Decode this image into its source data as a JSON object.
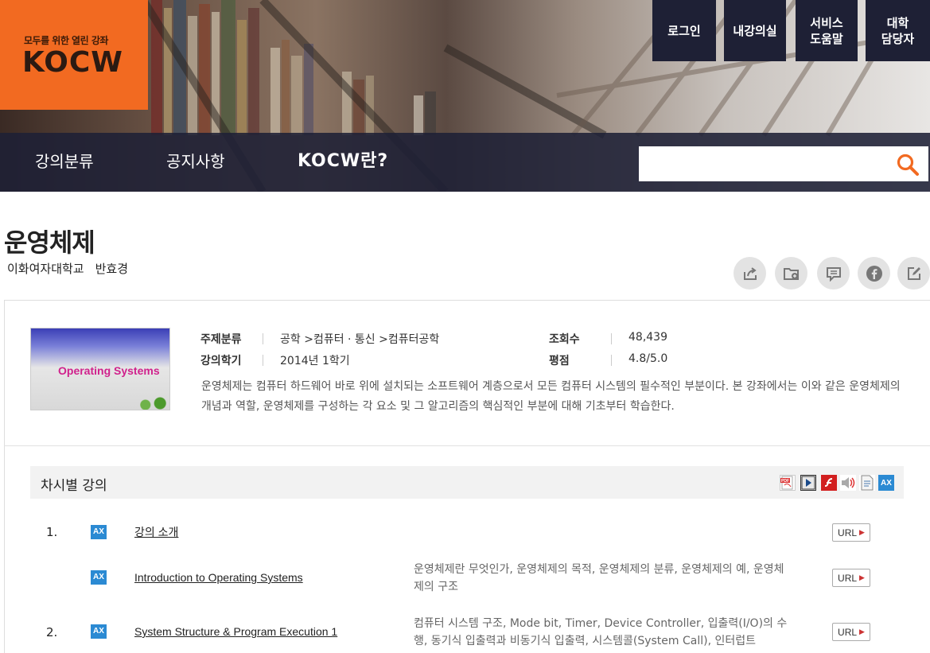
{
  "header": {
    "logo_tagline": "모두를 위한 열린 강좌",
    "logo_word": "KOCW",
    "top_buttons": [
      "로그인",
      "내강의실",
      "서비스\n도움말",
      "대학\n담당자"
    ],
    "nav": [
      "강의분류",
      "공지사항",
      "KOCW란?"
    ],
    "search": {
      "value": "",
      "placeholder": ""
    }
  },
  "course": {
    "title": "운영체제",
    "university": "이화여자대학교",
    "professor": "반효경",
    "thumbnail_title": "Operating Systems",
    "meta": {
      "subject_label": "주제분류",
      "subject_value": "공학 >컴퓨터 · 통신 >컴퓨터공학",
      "term_label": "강의학기",
      "term_value": "2014년 1학기",
      "views_label": "조회수",
      "views_value": "48,439",
      "rating_label": "평점",
      "rating_value": "4.8/5.0"
    },
    "description": "운영체제는 컴퓨터 하드웨어 바로 위에 설치되는 소프트웨어 계층으로서 모든 컴퓨터 시스템의 필수적인 부분이다. 본 강좌에서는 이와 같은 운영체제의 개념과 역할, 운영체제를 구성하는 각 요소 및 그 알고리즘의 핵심적인 부분에 대해 기초부터 학습한다."
  },
  "actions": [
    "share-icon",
    "folder-add-icon",
    "comment-icon",
    "facebook-icon",
    "edit-icon"
  ],
  "lectures": {
    "heading": "차시별 강의",
    "format_icons": [
      "pdf-icon",
      "video-icon",
      "flash-icon",
      "audio-icon",
      "document-icon",
      "ax-icon"
    ],
    "badge": "AX",
    "url_label": "URL",
    "rows": [
      {
        "num": "1.",
        "title": "강의 소개",
        "desc": ""
      },
      {
        "num": "",
        "title": "Introduction to Operating Systems",
        "desc": "운영체제란 무엇인가, 운영체제의 목적, 운영체제의 분류, 운영체제의 예, 운영체제의 구조"
      },
      {
        "num": "2.",
        "title": "System Structure & Program Execution 1",
        "desc": "컴퓨터 시스템 구조, Mode bit, Timer, Device Controller, 입출력(I/O)의 수행, 동기식 입출력과 비동기식 입출력, 시스템콜(System Call), 인터럽트(Interrupt)"
      }
    ]
  },
  "colors": {
    "brand_orange": "#f26a21",
    "nav_dark": "#1e2035",
    "ax_blue": "#2b8ad3",
    "search_orange": "#f26a21"
  }
}
